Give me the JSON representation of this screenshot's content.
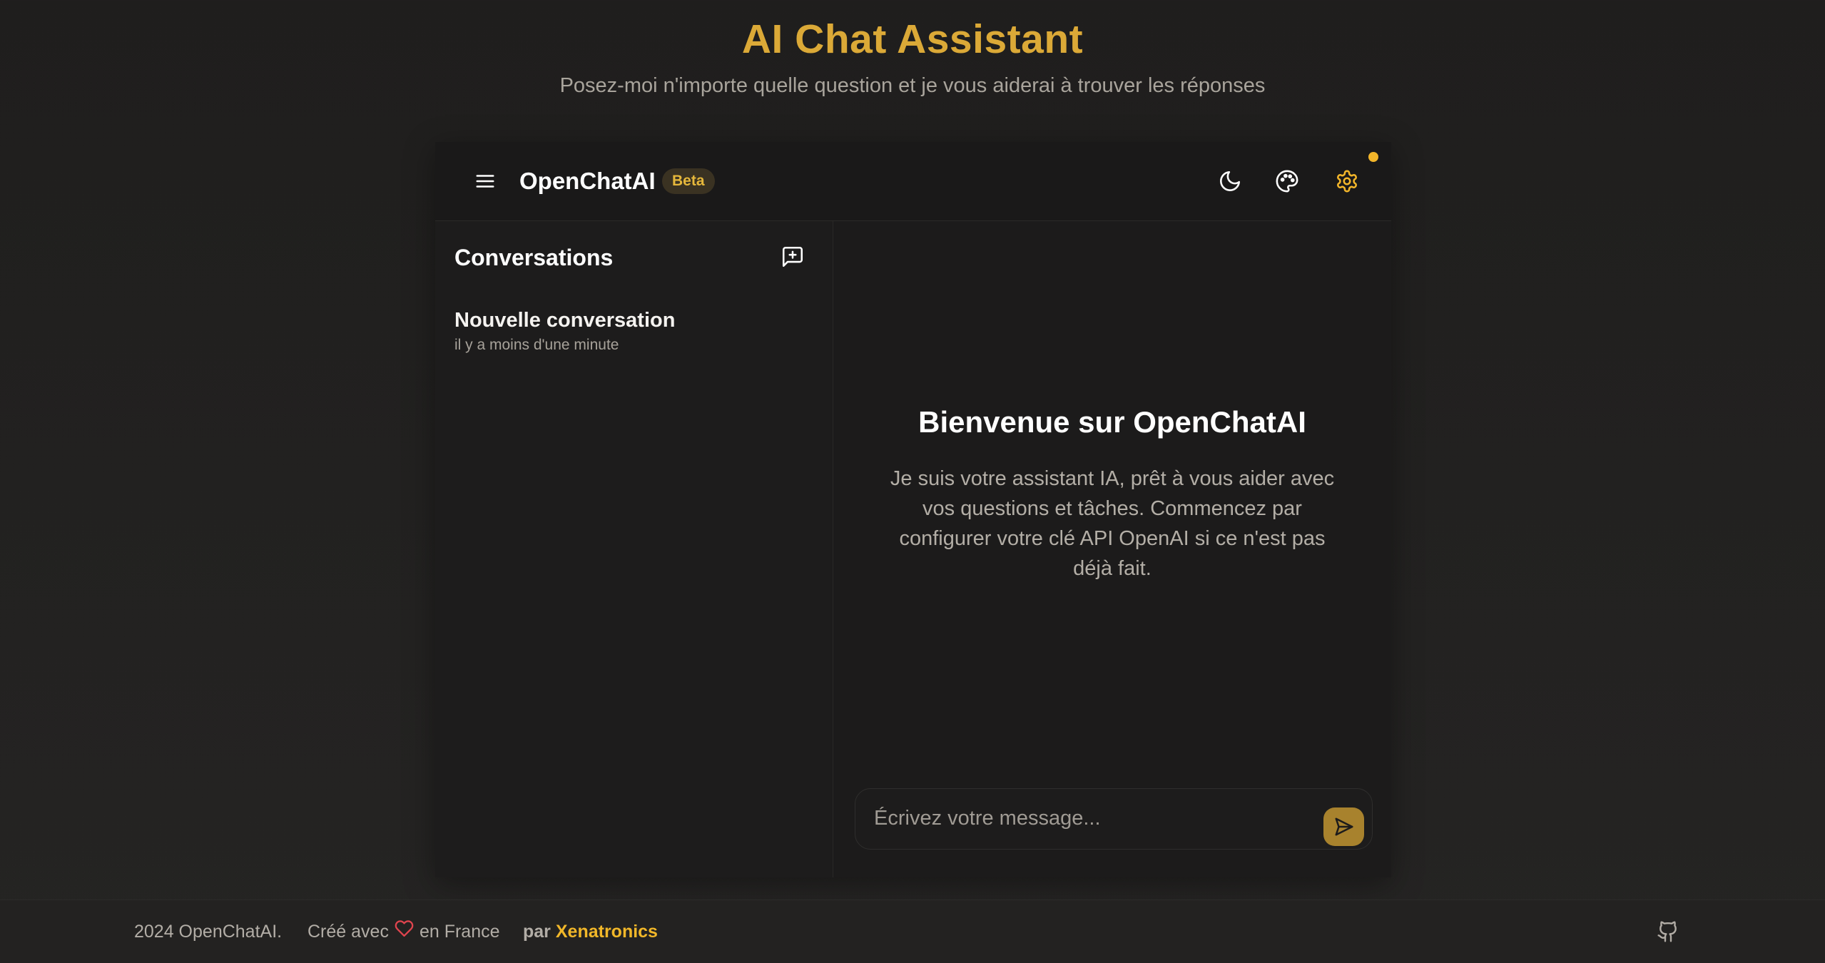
{
  "page": {
    "title": "AI Chat Assistant",
    "subtitle": "Posez-moi n'importe quelle question et je vous aiderai à trouver les réponses"
  },
  "app_header": {
    "brand": "OpenChatAI",
    "badge": "Beta",
    "icons": [
      "menu-icon",
      "moon-icon",
      "palette-icon",
      "gear-icon"
    ]
  },
  "sidebar": {
    "title": "Conversations",
    "new_icon": "message-plus-icon",
    "items": [
      {
        "title": "Nouvelle conversation",
        "time": "il y a moins d'une minute"
      }
    ]
  },
  "main": {
    "welcome_title": "Bienvenue sur OpenChatAI",
    "welcome_text": "Je suis votre assistant IA, prêt à vous aider avec vos questions et tâches. Commencez par configurer votre clé API OpenAI si ce n'est pas déjà fait.",
    "input_placeholder": "Écrivez votre message...",
    "input_value": "",
    "send_icon": "send-icon"
  },
  "footer": {
    "copyright": "2024 OpenChatAI.",
    "made_prefix": "Créé avec",
    "made_suffix": "en France",
    "by": "par",
    "author": "Xenatronics",
    "github_icon": "github-icon"
  },
  "colors": {
    "accent": "#dba937",
    "accent_bright": "#f2b52a",
    "background": "#1f1e1d",
    "heart": "#e0444e"
  }
}
